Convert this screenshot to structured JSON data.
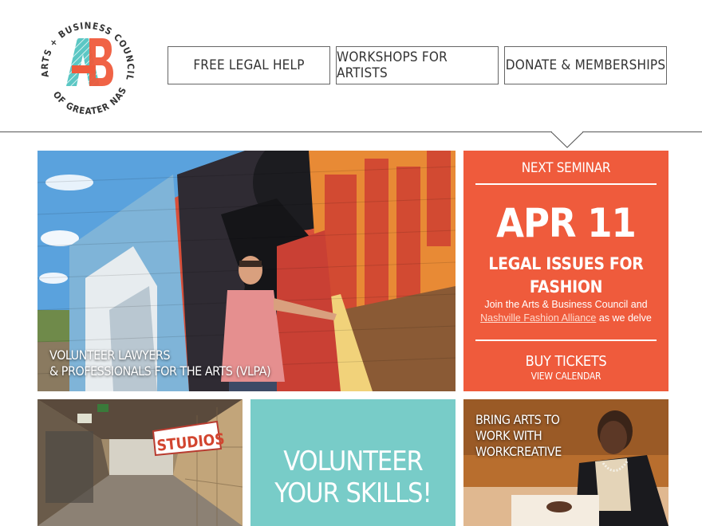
{
  "logo": {
    "arc_top": "ARTS + BUSINESS COUNCIL",
    "arc_bottom": "OF GREATER NASHVILLE",
    "mark": "AB"
  },
  "nav": {
    "items": [
      {
        "label": "FREE LEGAL HELP"
      },
      {
        "label": "WORKSHOPS FOR ARTISTS"
      },
      {
        "label": "DONATE & MEMBERSHIPS"
      }
    ]
  },
  "hero": {
    "caption_line1": "VOLUNTEER LAWYERS",
    "caption_line2": "& PROFESSIONALS FOR THE ARTS (VLPA)"
  },
  "seminar": {
    "heading": "NEXT SEMINAR",
    "date": "APR 11",
    "title_line1": "LEGAL ISSUES FOR",
    "title_line2": "FASHION",
    "desc_before": "Join the Arts & Business Council and",
    "desc_link": "Nashville Fashion Alliance",
    "desc_after": " as we delve",
    "buy_label": "BUY TICKETS",
    "calendar_label": "VIEW CALENDAR"
  },
  "studio": {
    "sign_text": "STUDIOS"
  },
  "volunteer": {
    "line1": "VOLUNTEER",
    "line2": "YOUR SKILLS!"
  },
  "work": {
    "line1": "BRING ARTS TO",
    "line2": "WORK WITH",
    "line3": "WORKCREATIVE"
  },
  "colors": {
    "seminar_bg": "#ef5b3c",
    "volunteer_bg": "#78ccc8",
    "logo_teal": "#5bc7c4",
    "logo_coral": "#ef5b3c"
  }
}
